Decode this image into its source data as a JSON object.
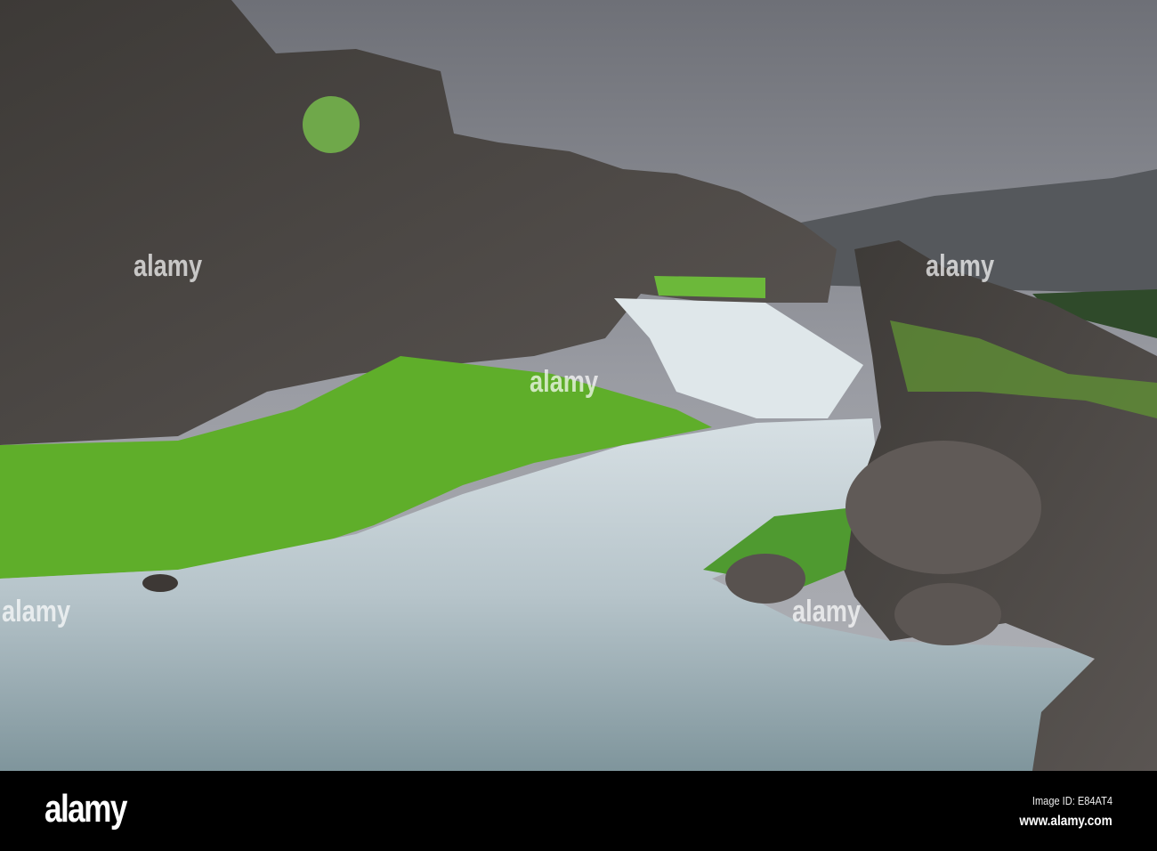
{
  "photo": {
    "subject": "waterfall-river-cliffs",
    "colors": {
      "sky": "#8a8d94",
      "rock": "#4a4643",
      "grass": "#5fae2a",
      "water": "#b9c6cc"
    }
  },
  "watermark": {
    "text": "alamy"
  },
  "footer": {
    "logo": "alamy",
    "image_id": "Image ID: E84AT4",
    "url": "www.alamy.com"
  }
}
